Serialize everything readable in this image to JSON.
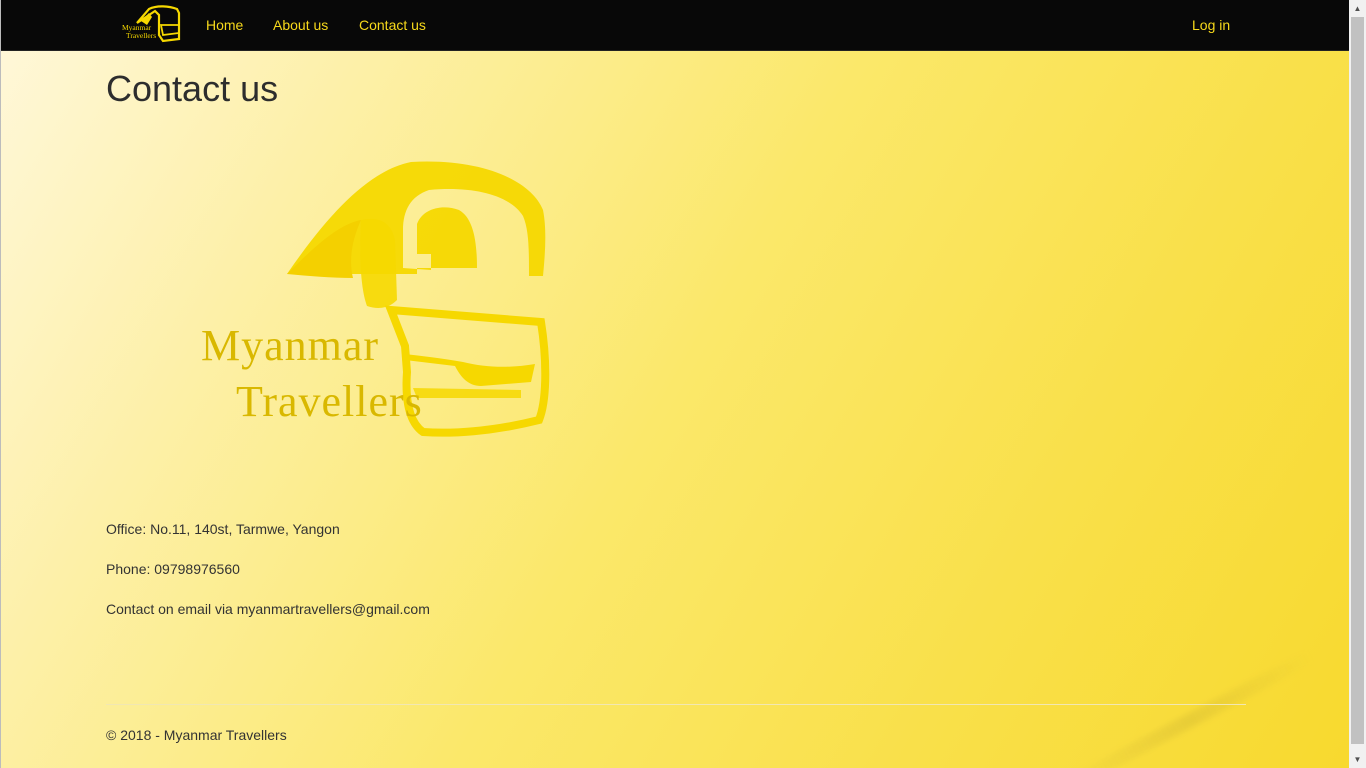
{
  "brand": {
    "logo_text_line1": "Myanmar",
    "logo_text_line2": "Travellers"
  },
  "nav": {
    "home": "Home",
    "about": "About us",
    "contact": "Contact us",
    "login": "Log in"
  },
  "main": {
    "title": "Contact us",
    "logo_text_line1": "Myanmar",
    "logo_text_line2": "Travellers",
    "office": "Office: No.11, 140st, Tarmwe, Yangon",
    "phone": "Phone: 09798976560",
    "email": "Contact on email via myanmartravellers@gmail.com"
  },
  "footer": {
    "copyright": "© 2018 - Myanmar Travellers"
  },
  "colors": {
    "navbar_bg": "#080808",
    "nav_link": "#f7d91b",
    "logo_yellow": "#f6d800",
    "text": "#333333"
  }
}
